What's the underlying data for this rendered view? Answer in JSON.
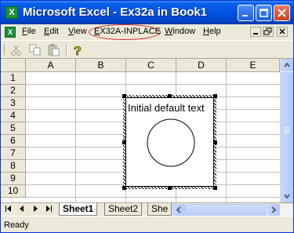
{
  "window": {
    "title": "Microsoft Excel - Ex32a in Book1",
    "app_icon_letter": "X"
  },
  "menu": {
    "items": [
      {
        "label": "File"
      },
      {
        "label": "Edit"
      },
      {
        "label": "View"
      },
      {
        "label": "EX32A-INPLACE"
      },
      {
        "label": "Window"
      },
      {
        "label": "Help"
      }
    ],
    "highlight_color": "#e02020"
  },
  "toolbar": {
    "tools": [
      "cut-icon",
      "copy-icon",
      "paste-icon",
      "help-icon"
    ]
  },
  "grid": {
    "columns": [
      "A",
      "B",
      "C",
      "D",
      "E"
    ],
    "rows": [
      "1",
      "2",
      "3",
      "4",
      "5",
      "6",
      "7",
      "8",
      "9",
      "10"
    ]
  },
  "embedded_object": {
    "text": "Initial default text",
    "shape": "circle"
  },
  "sheet_tabs": {
    "nav_buttons": [
      "first-sheet",
      "prev-sheet",
      "next-sheet",
      "last-sheet"
    ],
    "tabs": [
      {
        "label": "Sheet1",
        "active": true
      },
      {
        "label": "Sheet2",
        "active": false
      },
      {
        "label": "She",
        "active": false
      }
    ]
  },
  "status": {
    "text": "Ready"
  },
  "colors": {
    "title_bar": "#0053e1",
    "chrome": "#ece9d8",
    "grid_line": "#c0c0c0"
  }
}
